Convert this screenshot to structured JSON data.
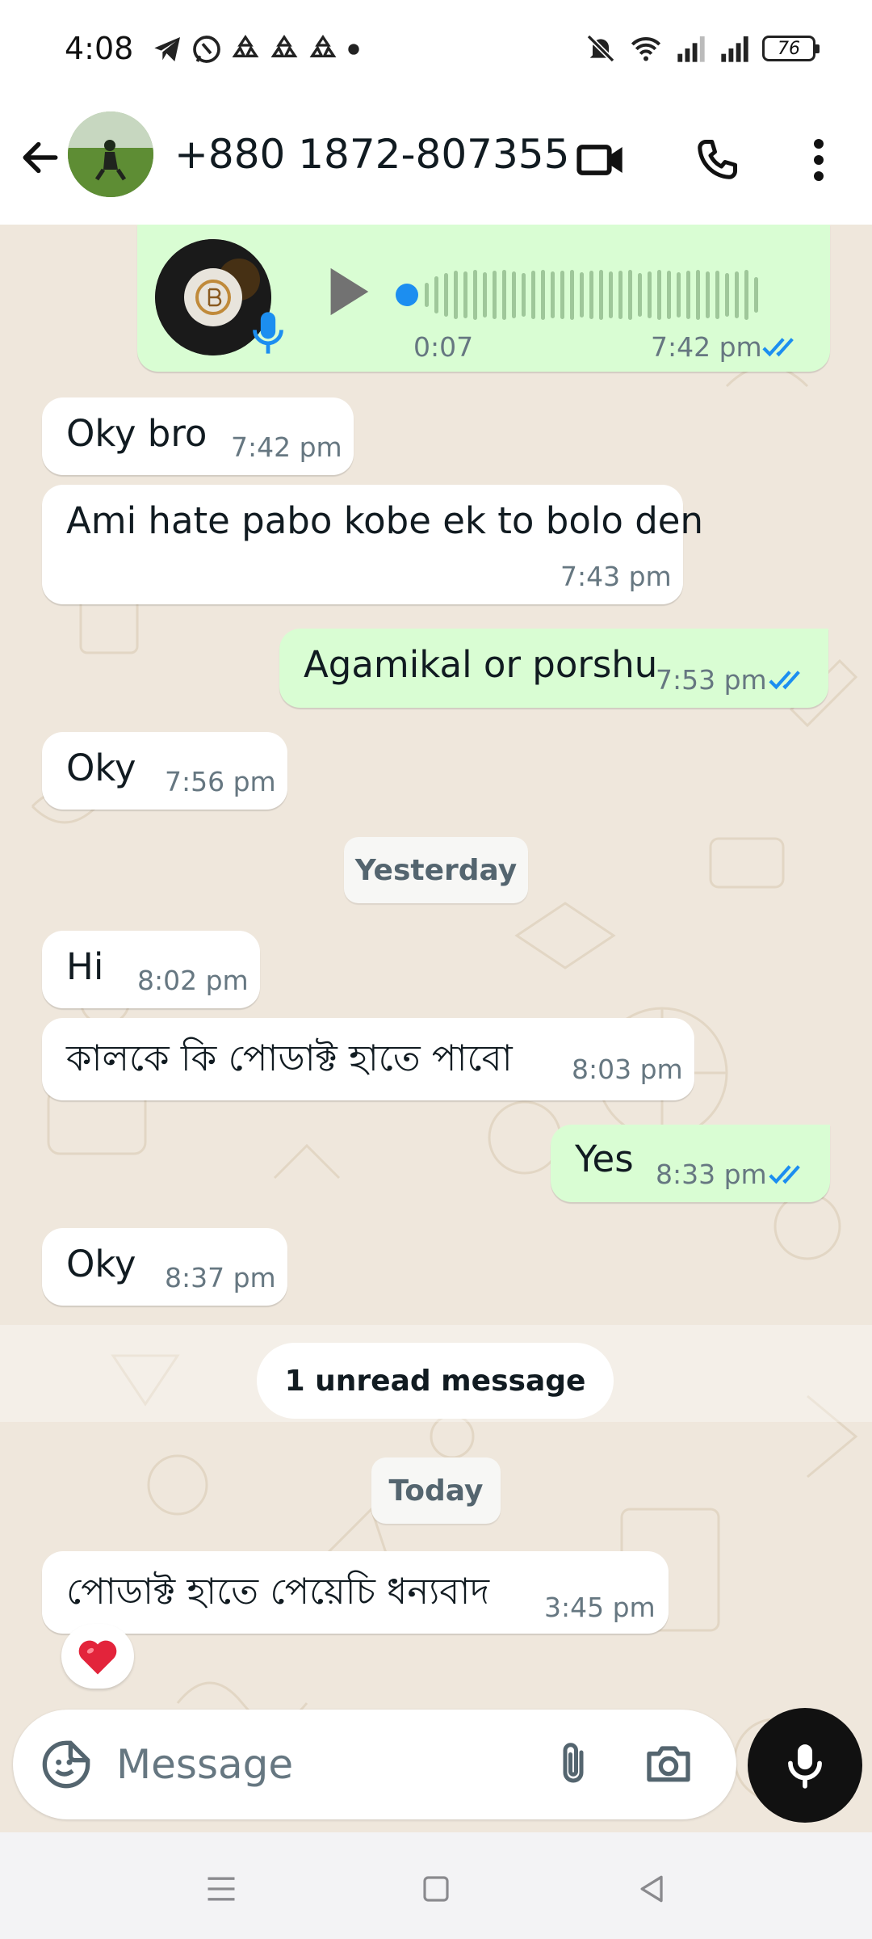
{
  "status_bar": {
    "time": "4:08",
    "battery": "76",
    "notification_icons": [
      "telegram-icon",
      "whatsapp-icon",
      "recycle-icon",
      "recycle-icon",
      "recycle-icon",
      "dot-icon"
    ],
    "right_icons": [
      "bell-muted-icon",
      "wifi-icon",
      "signal-icon",
      "signal-icon",
      "battery-icon"
    ]
  },
  "header": {
    "contact_name": "+880 1872-807355",
    "actions": [
      "video-call-icon",
      "voice-call-icon",
      "more-options-icon"
    ]
  },
  "voice_message": {
    "duration": "0:07",
    "time": "7:42 pm",
    "status": "read"
  },
  "messages": [
    {
      "direction": "in",
      "text": "Oky bro",
      "time": "7:42 pm"
    },
    {
      "direction": "in",
      "text": "Ami hate pabo kobe ek to bolo den",
      "time": "7:43 pm"
    },
    {
      "direction": "out",
      "text": "Agamikal or porshu",
      "time": "7:53 pm",
      "status": "read"
    },
    {
      "direction": "in",
      "text": "Oky",
      "time": "7:56 pm"
    },
    {
      "direction": "in",
      "text": "Hi",
      "time": "8:02 pm"
    },
    {
      "direction": "in",
      "text": "কালকে কি পোডাক্ট হাতে পাবো",
      "time": "8:03 pm"
    },
    {
      "direction": "out",
      "text": "Yes",
      "time": "8:33 pm",
      "status": "read"
    },
    {
      "direction": "in",
      "text": "Oky",
      "time": "8:37 pm"
    },
    {
      "direction": "in",
      "text": "পোডাক্ট হাতে পেয়েচি ধন্যবাদ",
      "time": "3:45 pm",
      "reaction": "❤️"
    }
  ],
  "dividers": {
    "yesterday": "Yesterday",
    "unread": "1 unread message",
    "today": "Today"
  },
  "input": {
    "placeholder": "Message"
  },
  "colors": {
    "chat_background": "#efe7dc",
    "outgoing_bubble": "#d9fdd3",
    "incoming_bubble": "#ffffff",
    "read_ticks": "#1c8ef0",
    "mic_button": "#111111"
  }
}
